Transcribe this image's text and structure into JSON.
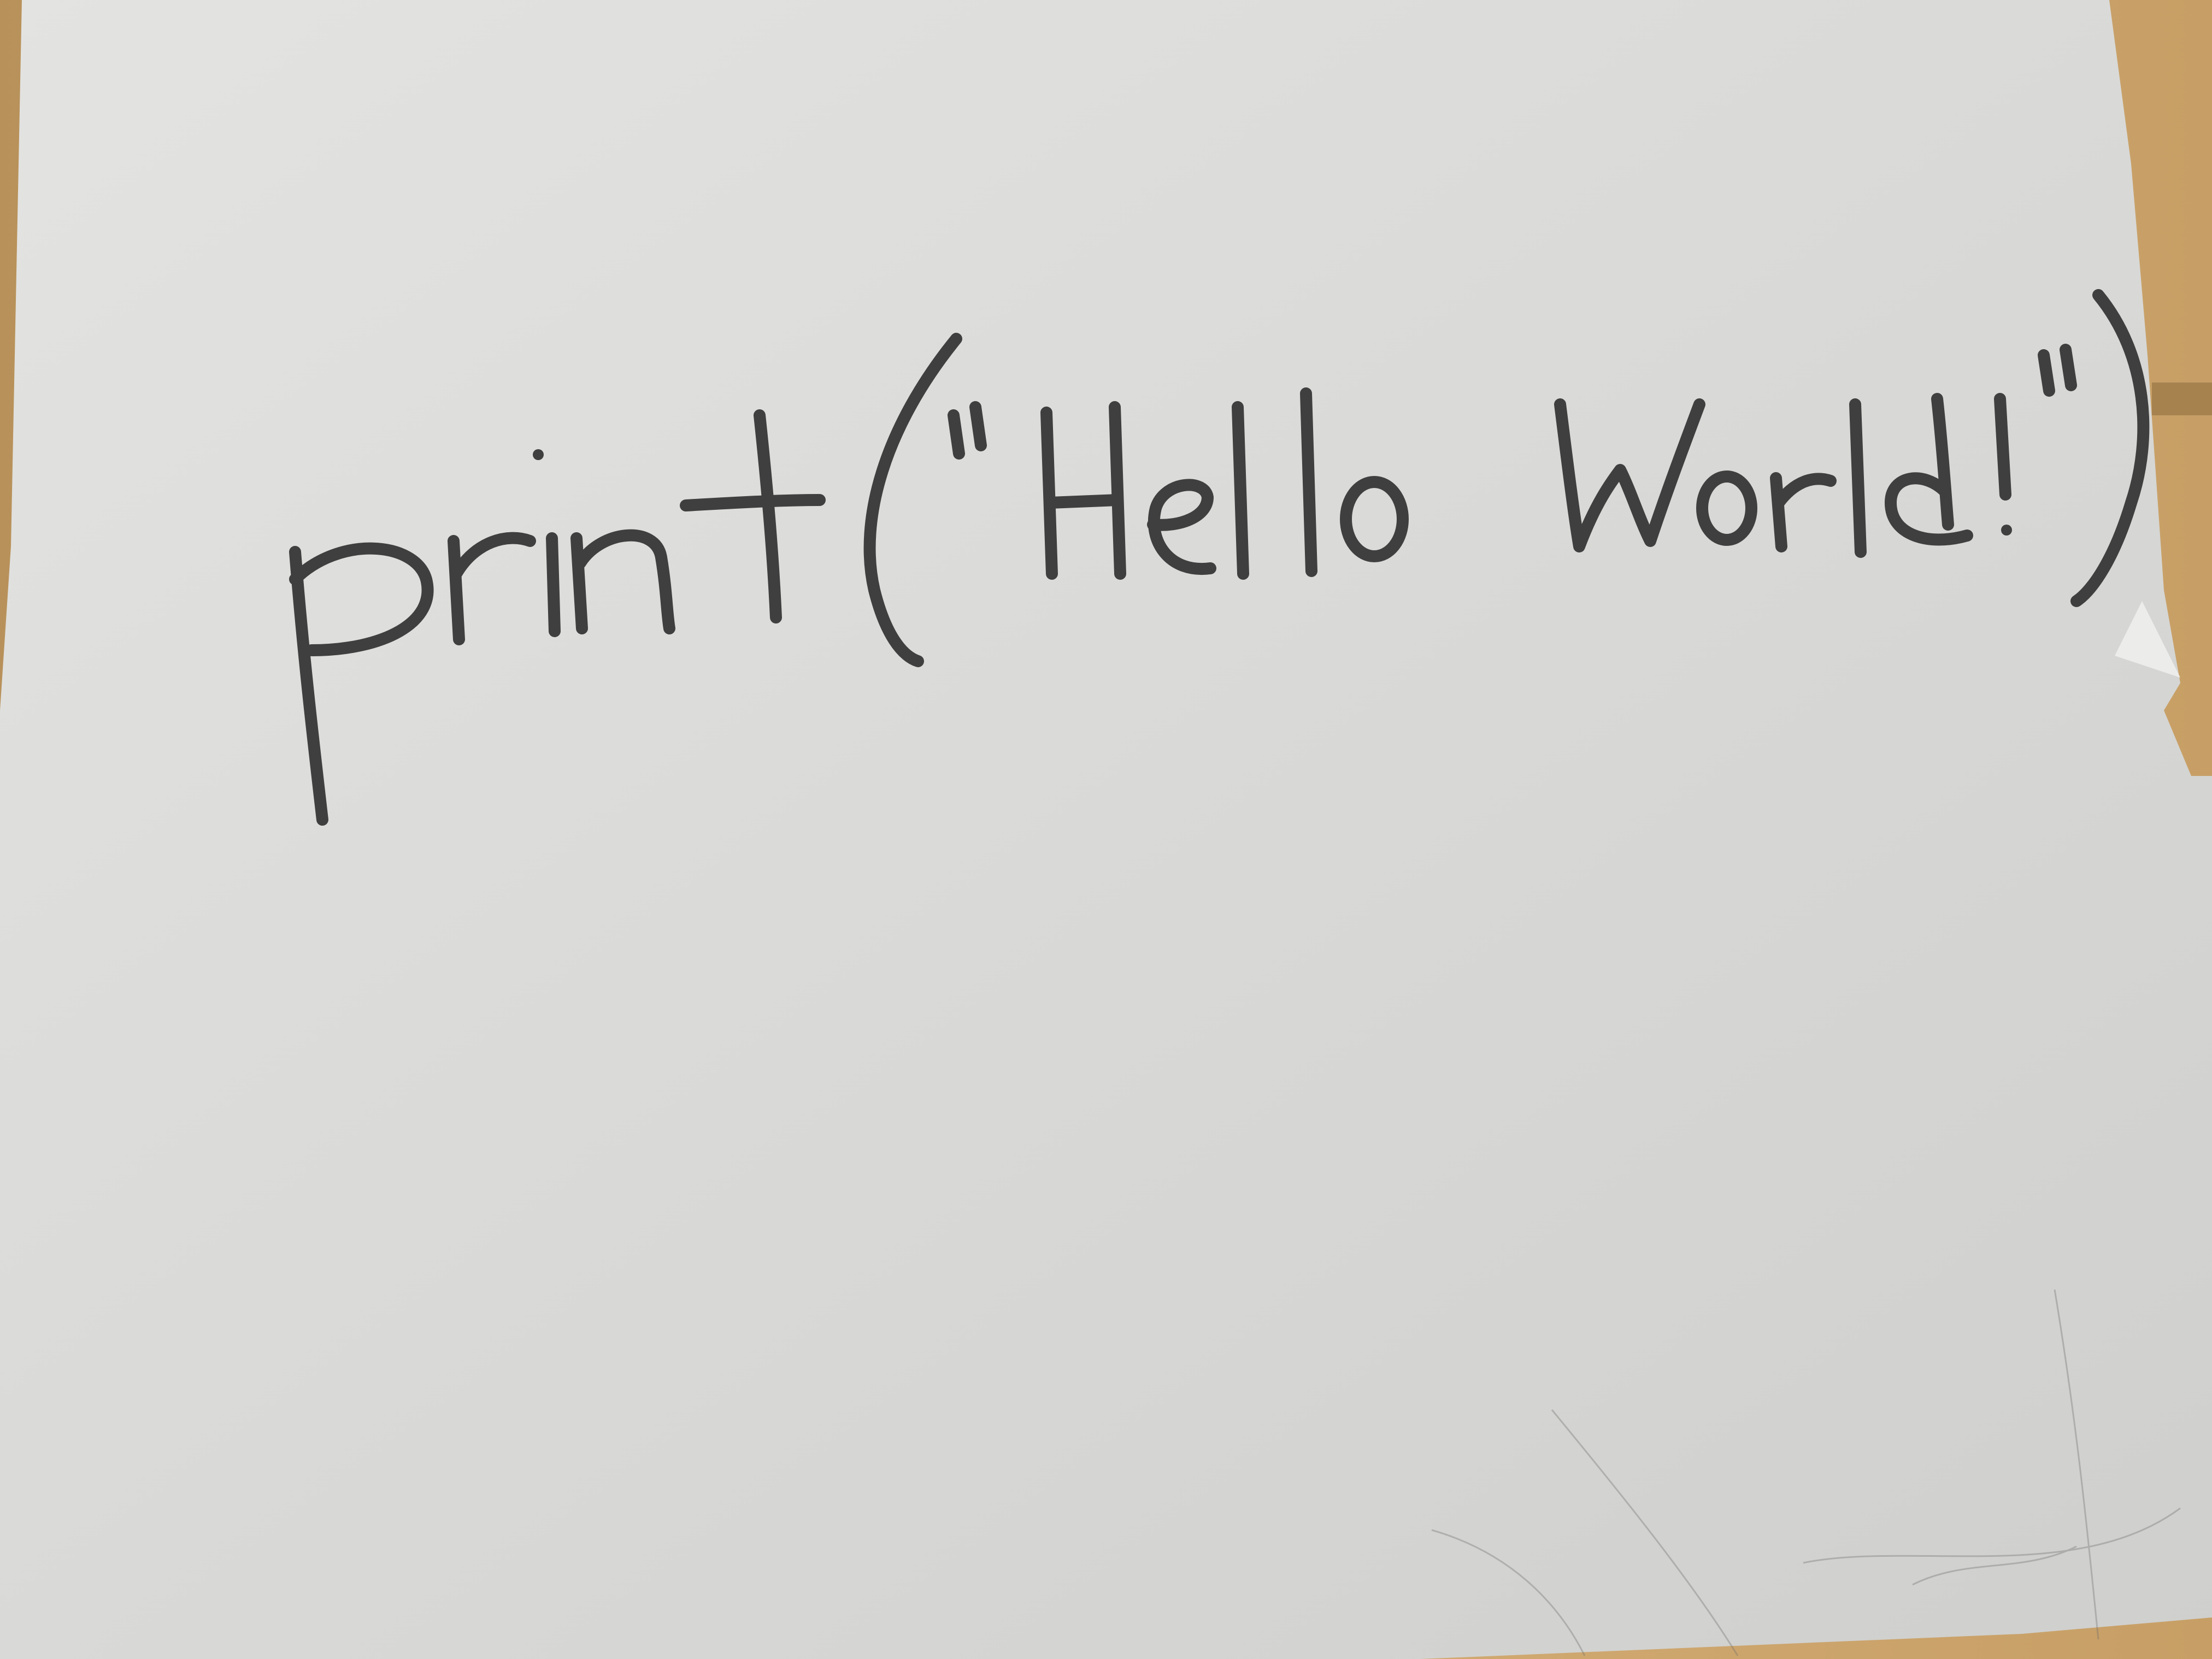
{
  "photo": {
    "handwriting": {
      "text": "print(\"Hello World!\")",
      "ink_color": "#3f3f3f"
    },
    "colors": {
      "paper": "#d8d8d6",
      "paper_highlight": "#e2e2e0",
      "desk_wood": "#c9a36a"
    }
  }
}
